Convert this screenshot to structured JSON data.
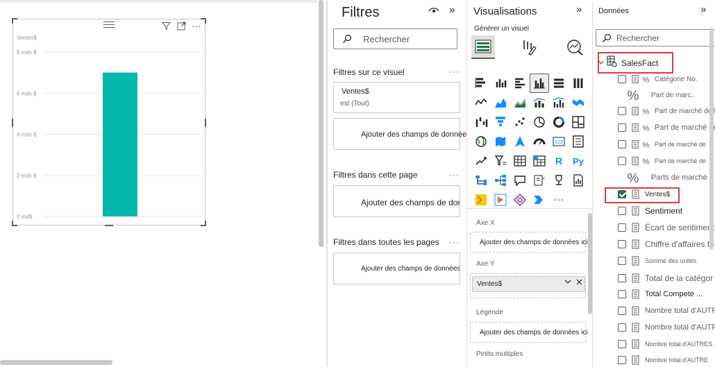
{
  "chart_data": {
    "type": "bar",
    "title": "",
    "ylabel": "Ventes$",
    "yticks": [
      "0 md$",
      "2 mds $",
      "4 mds $",
      "6 mds $",
      "8 mds $"
    ],
    "ylim": [
      0,
      8
    ],
    "categories": [
      ""
    ],
    "values": [
      7.0
    ],
    "color": "#01B8AA",
    "grid": true
  },
  "visual": {
    "header_icons": [
      "filter-icon",
      "focus-mode-icon",
      "more-options-icon"
    ]
  },
  "filters": {
    "title": "Filtres",
    "search_placeholder": "Rechercher",
    "section_visual": "Filtres sur ce visuel",
    "section_page": "Filtres dans cette page",
    "section_all": "Filtres dans toutes les pages",
    "more": "···",
    "card_title": "Ventes$",
    "card_sub": "est (Tout)",
    "add_fields": "Ajouter des champs de données ici"
  },
  "visualizations": {
    "title": "Visualisations",
    "build_label": "Générer un visuel",
    "more": "···",
    "wells": [
      {
        "label": "Axe X",
        "placeholder": "Ajouter des champs de données ici"
      },
      {
        "label": "Axe Y",
        "field": "Ventes$"
      },
      {
        "label": "Légende",
        "placeholder": "Ajouter des champs de données ici"
      },
      {
        "label": "Petits multiples"
      }
    ],
    "text_icons": {
      "card": "123",
      "r": "R",
      "py": "Py"
    }
  },
  "data_pane": {
    "title": "Données",
    "search_placeholder": "Rechercher",
    "table": "SalesFact",
    "fields": [
      {
        "name": "Catégorie No.",
        "icon": "percent",
        "checked": false
      },
      {
        "name": "Part de marc..",
        "icon": "percent-big",
        "checked": null
      },
      {
        "name": "Part de marché de l'u",
        "icon": "percent",
        "checked": false
      },
      {
        "name": "Part de marché de",
        "icon": "percent",
        "checked": false
      },
      {
        "name": "Part de marché de",
        "icon": "percent",
        "checked": false
      },
      {
        "name": "Part de marché de",
        "icon": "percent",
        "checked": false
      },
      {
        "name": "Parts de marché",
        "icon": "percent-big",
        "checked": null
      },
      {
        "name": "Ventes$",
        "icon": "calc",
        "checked": true
      },
      {
        "name": "Sentiment",
        "icon": "calc",
        "checked": false
      },
      {
        "name": "Écart de sentiment",
        "icon": "calc",
        "checked": false
      },
      {
        "name": "Chiffre d'affaires to",
        "icon": "calc",
        "checked": false
      },
      {
        "name": "Somme des unités",
        "icon": "calc",
        "checked": false
      },
      {
        "name": "Total de la catégor",
        "icon": "calc",
        "checked": false
      },
      {
        "name": "Total Compete ...",
        "icon": "calc",
        "checked": false
      },
      {
        "name": "Nombre total d'AUTR",
        "icon": "calc",
        "checked": false
      },
      {
        "name": "Nombre total d'AUTR",
        "icon": "calc",
        "checked": false
      },
      {
        "name": "Nombre total d'AUTRES",
        "icon": "calc",
        "checked": false
      },
      {
        "name": "Nombre total d'AUTRE",
        "icon": "calc",
        "checked": false
      }
    ]
  }
}
